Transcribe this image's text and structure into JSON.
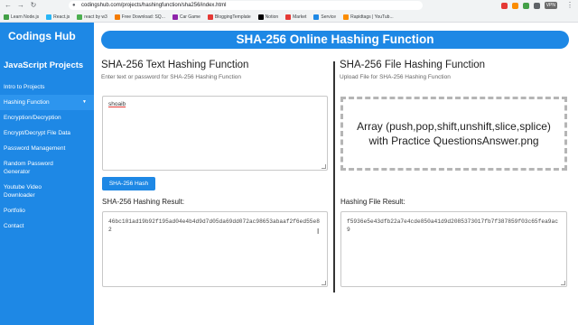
{
  "browser": {
    "url": "codingshub.com/projects/hashingfunction/sha256/index.html",
    "vpn_label": "VPN",
    "bookmarks": [
      {
        "label": "Learn Node.js",
        "color": "#43a047"
      },
      {
        "label": "React.js",
        "color": "#29b6f6"
      },
      {
        "label": "react by w3",
        "color": "#4caf50"
      },
      {
        "label": "Free Download: SQ...",
        "color": "#f57c00"
      },
      {
        "label": "Car Game",
        "color": "#8e24aa"
      },
      {
        "label": "BloggingTemplate",
        "color": "#e53935"
      },
      {
        "label": "Notion",
        "color": "#000000"
      },
      {
        "label": "Market",
        "color": "#e53935"
      },
      {
        "label": "Service",
        "color": "#1e88e5"
      },
      {
        "label": "Rapidtags | YouTub...",
        "color": "#fb8c00"
      }
    ]
  },
  "sidebar": {
    "brand": "Codings Hub",
    "section": "JavaScript Projects",
    "items": [
      {
        "label": "Intro to Projects"
      },
      {
        "label": "Hashing Function",
        "caret": "▼"
      },
      {
        "label": "Encryption/Decryption"
      },
      {
        "label": "Encrypt/Decrypt File Data"
      },
      {
        "label": "Password Management"
      },
      {
        "label": "Random Password Generator"
      },
      {
        "label": "Youtube Video Downloader"
      },
      {
        "label": "Portfolio"
      },
      {
        "label": "Contact"
      }
    ]
  },
  "main": {
    "banner": "SHA-256 Online Hashing Function",
    "text_section": {
      "title": "SHA-256 Text Hashing Function",
      "subtitle": "Enter text or password for SHA-256 Hashing Function",
      "input_value": "shoaib",
      "button_label": "SHA-256 Hash",
      "result_label": "SHA-256 Hashing Result:",
      "result_value": "46bc101ad19b92f195ad04e4b4d9d7d05da69dd072ac98653abaaf2f6ed55e82"
    },
    "file_section": {
      "title": "SHA-256 File Hashing Function",
      "subtitle": "Upload File for SHA-256 Hashing Function",
      "file_name": "Array (push,pop,shift,unshift,slice,splice) with Practice QuestionsAnswer.png",
      "result_label": "Hashing File Result:",
      "result_value": "f5936e5e43dfb22a7e4cde850a41d9d2085373017fb7f387859f03c65fea9ac9"
    }
  },
  "colors": {
    "primary": "#1e88e5",
    "active_item": "#2d95ee"
  }
}
